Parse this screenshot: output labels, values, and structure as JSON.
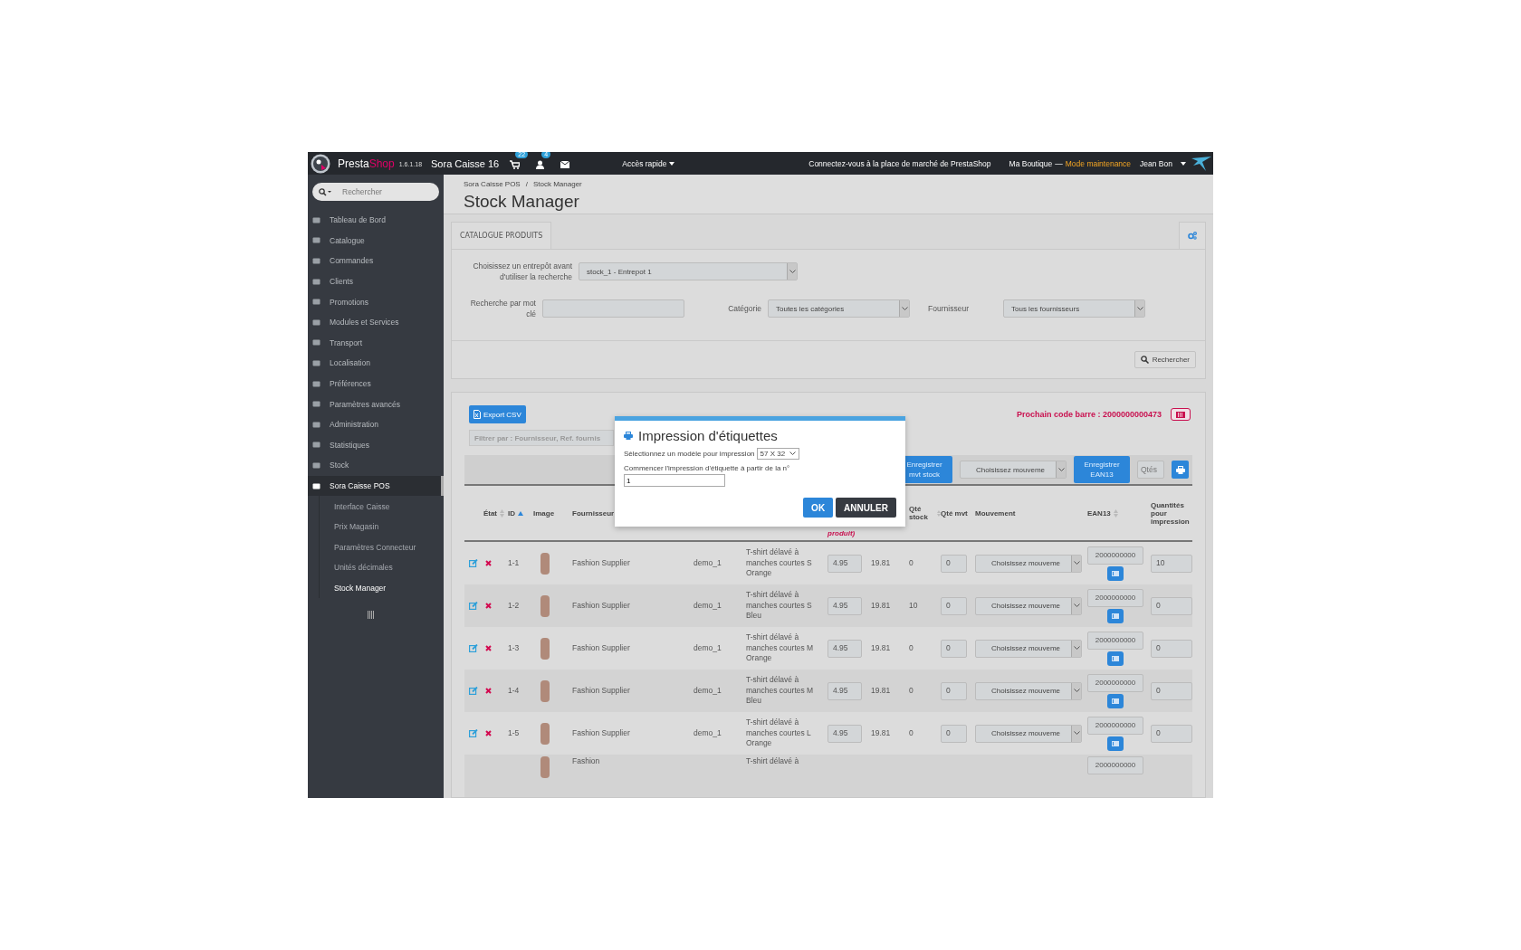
{
  "topbar": {
    "brand": "Presta",
    "brand_accent": "Shop",
    "version": "1.6.1.18",
    "shop_name": "Sora Caisse 16",
    "cart_count": "22",
    "customers_count": "4",
    "quick_access": "Accès rapide",
    "marketplace_link": "Connectez-vous à la place de marché de PrestaShop",
    "shop": "Ma Boutique",
    "separator": "—",
    "maintenance": "Mode maintenance",
    "user": "Jean Bon"
  },
  "sidebar": {
    "search": {
      "placeholder": "Rechercher"
    },
    "items": [
      {
        "label": "Tableau de Bord",
        "selected": false
      },
      {
        "label": "Catalogue",
        "selected": false
      },
      {
        "label": "Commandes",
        "selected": false
      },
      {
        "label": "Clients",
        "selected": false
      },
      {
        "label": "Promotions",
        "selected": false
      },
      {
        "label": "Modules et Services",
        "selected": false
      },
      {
        "label": "Transport",
        "selected": false
      },
      {
        "label": "Localisation",
        "selected": false
      },
      {
        "label": "Préférences",
        "selected": false
      },
      {
        "label": "Paramètres avancés",
        "selected": false
      },
      {
        "label": "Administration",
        "selected": false
      },
      {
        "label": "Statistiques",
        "selected": false
      },
      {
        "label": "Stock",
        "selected": false
      },
      {
        "label": "Sora Caisse POS",
        "selected": true,
        "children": [
          {
            "label": "Interface Caisse",
            "selected": false
          },
          {
            "label": "Prix Magasin",
            "selected": false
          },
          {
            "label": "Paramètres Connecteur",
            "selected": false
          },
          {
            "label": "Unités décimales",
            "selected": false
          },
          {
            "label": "Stock Manager",
            "selected": true
          }
        ]
      }
    ]
  },
  "breadcrumb": [
    "Sora Caisse POS",
    "Stock Manager"
  ],
  "breadcrumb_separator": "/",
  "page_title": "Stock Manager",
  "search_panel": {
    "tab": {
      "label": "CATALOGUE PRODUITS",
      "selected": true
    },
    "warehouse": {
      "label": "Choisissez un entrepôt avant d'utiliser la recherche",
      "value": "stock_1 - Entrepot 1"
    },
    "keyword": {
      "label": "Recherche par mot clé"
    },
    "category": {
      "label": "Catégorie",
      "value": "Toutes les catégories"
    },
    "supplier": {
      "label": "Fournisseur",
      "value": "Tous les fournisseurs"
    },
    "search_button": "Rechercher"
  },
  "products_panel": {
    "export_button": "Export CSV",
    "filter": {
      "placeholder": "Filtrer par : Fournisseur, Ref. fournis"
    },
    "next_barcode": "Prochain code barre : 2000000000473",
    "save_movement_button": "Enregistrer mvt stock",
    "movement_select": "Choisissez mouveme",
    "save_ean_button": "Enregistrer EAN13",
    "qty_field": {
      "placeholder": "Qtés"
    },
    "table": {
      "columns": [
        {
          "kind": "sortable",
          "label": "État"
        },
        {
          "kind": "sorted",
          "label": "ID"
        },
        {
          "kind": "plain",
          "label": "Image"
        },
        {
          "kind": "plain",
          "label": "Fournisseur"
        },
        {
          "kind": "plain"
        },
        {
          "kind": "plain"
        },
        {
          "kind": "note",
          "label": "produit)"
        },
        {
          "kind": "plain"
        },
        {
          "kind": "sortable",
          "label": "Qté stock"
        },
        {
          "kind": "plain",
          "label": "Qté mvt"
        },
        {
          "kind": "plain",
          "label": "Mouvement"
        },
        {
          "kind": "sortable",
          "label": "EAN13"
        },
        {
          "kind": "plain",
          "label": "Quantités pour impression"
        }
      ],
      "rows": [
        {
          "kind": "full",
          "id": "1-1",
          "supplier": "Fashion Supplier",
          "ref": "demo_1",
          "name": "T-shirt délavé à manches courtes S Orange",
          "price": "4.95",
          "price_ttc": "19.81",
          "stock": "0",
          "mvt": "0",
          "movement": "Choisissez mouveme",
          "ean": "2000000000",
          "print_qty": "10"
        },
        {
          "kind": "full",
          "id": "1-2",
          "supplier": "Fashion Supplier",
          "ref": "demo_1",
          "name": "T-shirt délavé à manches courtes S Bleu",
          "price": "4.95",
          "price_ttc": "19.81",
          "stock": "10",
          "mvt": "0",
          "movement": "Choisissez mouveme",
          "ean": "2000000000",
          "print_qty": "0"
        },
        {
          "kind": "full",
          "id": "1-3",
          "supplier": "Fashion Supplier",
          "ref": "demo_1",
          "name": "T-shirt délavé à manches courtes M Orange",
          "price": "4.95",
          "price_ttc": "19.81",
          "stock": "0",
          "mvt": "0",
          "movement": "Choisissez mouveme",
          "ean": "2000000000",
          "print_qty": "0"
        },
        {
          "kind": "full",
          "id": "1-4",
          "supplier": "Fashion Supplier",
          "ref": "demo_1",
          "name": "T-shirt délavé à manches courtes M Bleu",
          "price": "4.95",
          "price_ttc": "19.81",
          "stock": "0",
          "mvt": "0",
          "movement": "Choisissez mouveme",
          "ean": "2000000000",
          "print_qty": "0"
        },
        {
          "kind": "full",
          "id": "1-5",
          "supplier": "Fashion Supplier",
          "ref": "demo_1",
          "name": "T-shirt délavé à manches courtes L Orange",
          "price": "4.95",
          "price_ttc": "19.81",
          "stock": "0",
          "mvt": "0",
          "movement": "Choisissez mouveme",
          "ean": "2000000000",
          "print_qty": "0"
        },
        {
          "kind": "partial",
          "supplier": "Fashion",
          "name": "T-shirt délavé à",
          "ean": "2000000000"
        }
      ]
    }
  },
  "modal": {
    "title": "Impression d'étiquettes",
    "template_label": "Sélectionnez un modèle pour impression",
    "template_value": "57 X 32",
    "start_label": "Commencer l'impression d'étiquette à partir de la n°",
    "start_value": "1",
    "ok_button": "OK",
    "cancel_button": "ANNULER"
  }
}
